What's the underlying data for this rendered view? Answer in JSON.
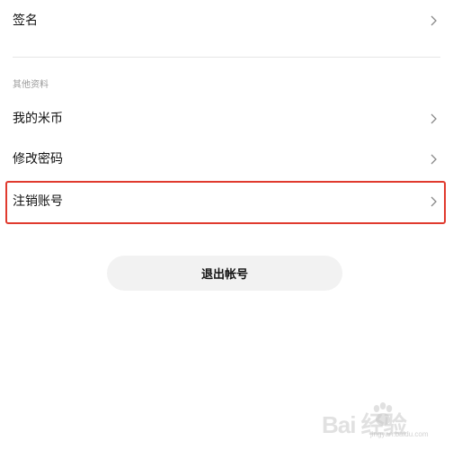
{
  "rows": {
    "signature": {
      "label": "签名"
    },
    "mi_coins": {
      "label": "我的米币"
    },
    "change_password": {
      "label": "修改密码"
    },
    "delete_account": {
      "label": "注销账号"
    }
  },
  "section": {
    "other_info": "其他资料"
  },
  "logout": {
    "label": "退出帐号"
  },
  "watermark": {
    "brand": "Bai  经验",
    "site": "jingyan.baidu.com"
  },
  "colors": {
    "highlight": "#e03a2e",
    "divider": "#e6e6e6",
    "button_bg": "#f2f2f2",
    "chevron": "#8a8a8a",
    "section_text": "#9b9b9b"
  }
}
